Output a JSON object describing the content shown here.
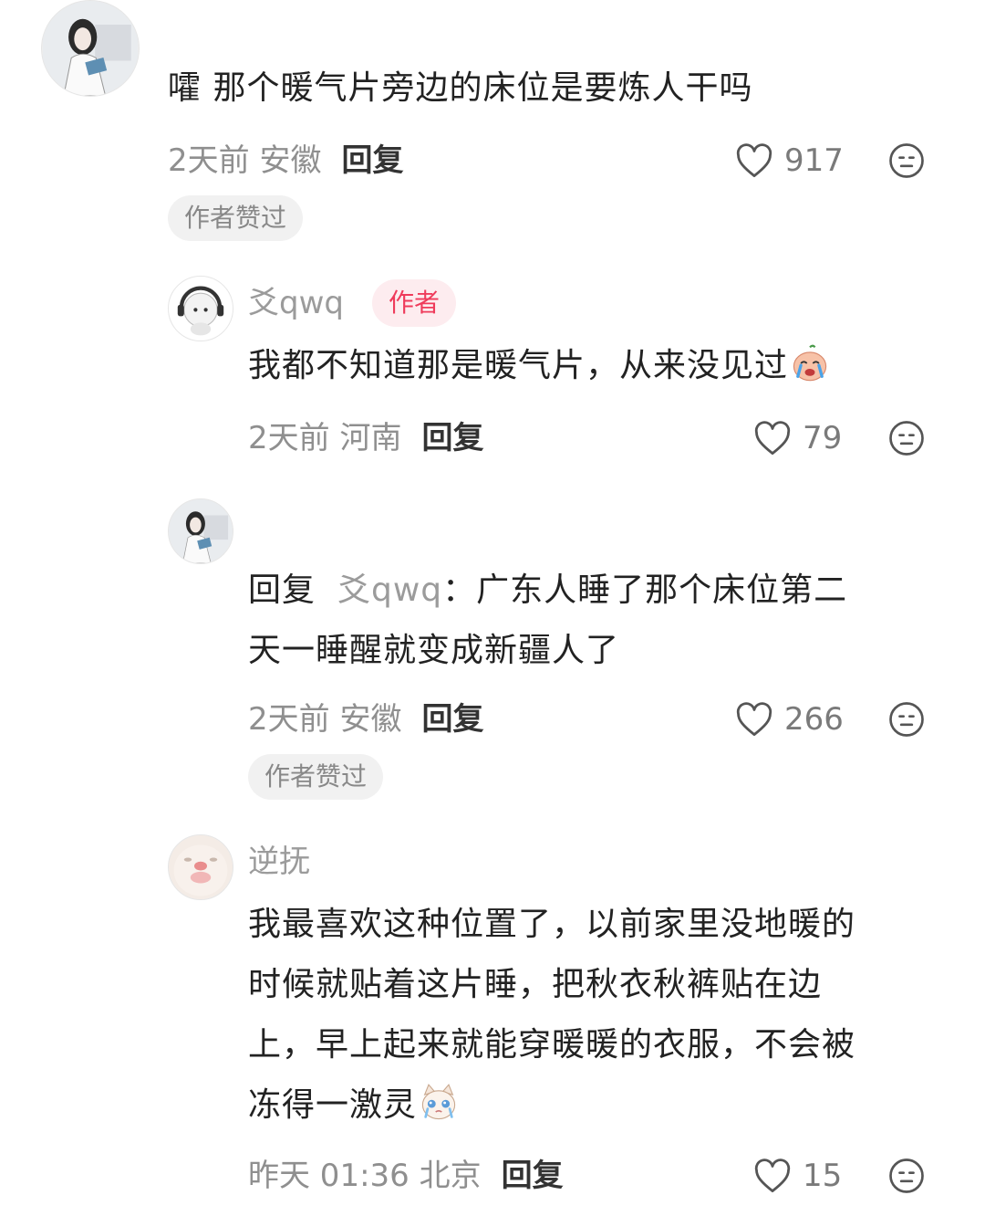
{
  "comments": [
    {
      "text": "嚯 那个暖气片旁边的床位是要炼人干吗",
      "meta_time_location": "2天前 安徽",
      "reply_label": "回复",
      "likes": "917",
      "chip": "作者赞过"
    },
    {
      "username": "爻qwq",
      "badge": "作者",
      "text": "我都不知道那是暖气片，从来没见过",
      "meta_time_location": "2天前 河南",
      "reply_label": "回复",
      "likes": "79"
    },
    {
      "reply_prefix": "回复",
      "reply_target": "爻qwq",
      "lines": [
        "：广东人睡了那个床位第二",
        "天一睡醒就变成新疆人了"
      ],
      "meta_time_location": "2天前 安徽",
      "reply_label": "回复",
      "likes": "266",
      "chip": "作者赞过"
    },
    {
      "username": "逆抚",
      "lines": [
        "我最喜欢这种位置了，以前家里没地暖的",
        "时候就贴着这片睡，把秋衣秋裤贴在边",
        "上，早上起来就能穿暖暖的衣服，不会被",
        "冻得一激灵"
      ],
      "meta_time_location": "昨天 01:36 北京",
      "reply_label": "回复",
      "likes": "15"
    }
  ],
  "colors": {
    "author_badge_text": "#ef3b5b",
    "author_badge_bg": "#fdecef"
  },
  "icons": [
    "heart-icon",
    "dislike-face-icon",
    "crying-face-emoji",
    "crying-cat-emoji"
  ]
}
